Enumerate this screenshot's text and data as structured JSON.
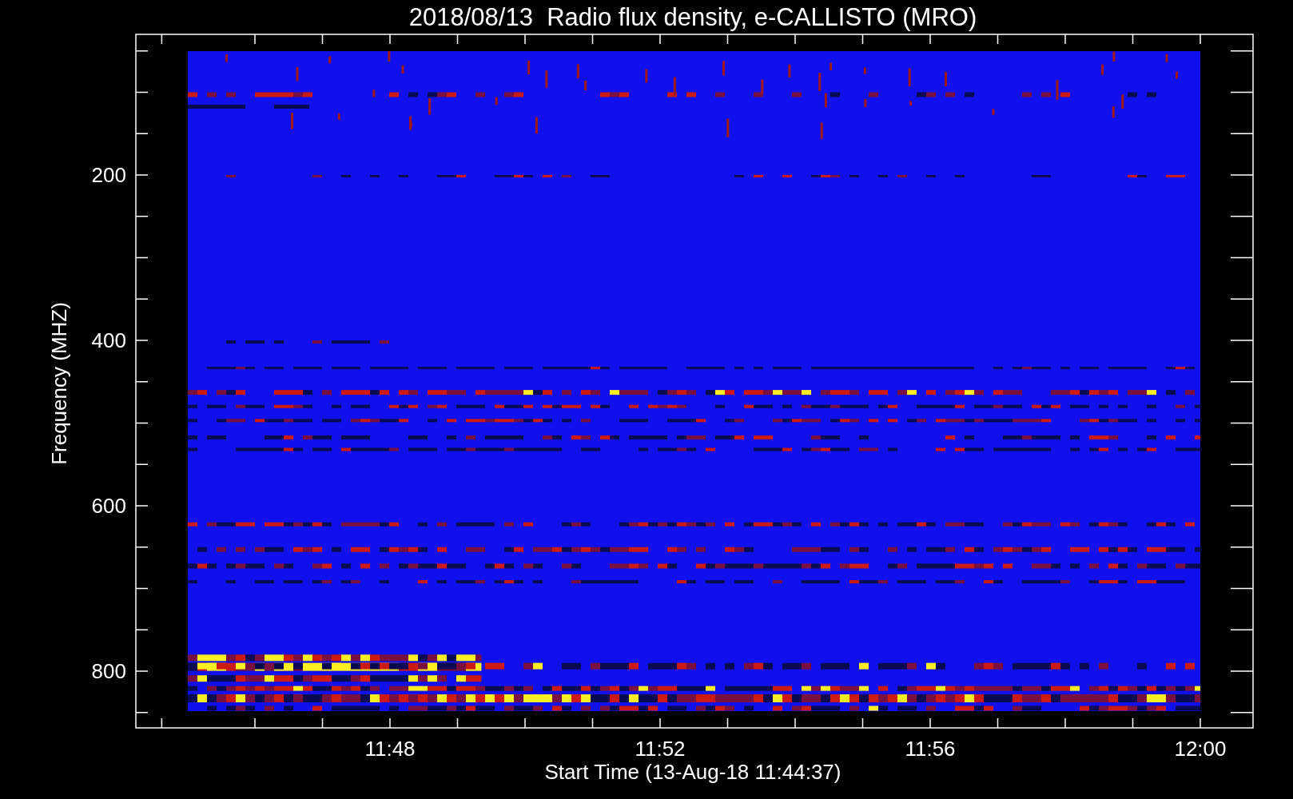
{
  "title": "2018/08/13  Radio flux density, e-CALLISTO (MRO)",
  "y_axis": {
    "label": "Frequency (MHZ)",
    "ticks": [
      "200",
      "400",
      "600",
      "800"
    ]
  },
  "x_axis": {
    "label": "Start Time (13-Aug-18 11:44:37)",
    "ticks": [
      "11:48",
      "11:52",
      "11:56",
      "12:00"
    ]
  }
}
